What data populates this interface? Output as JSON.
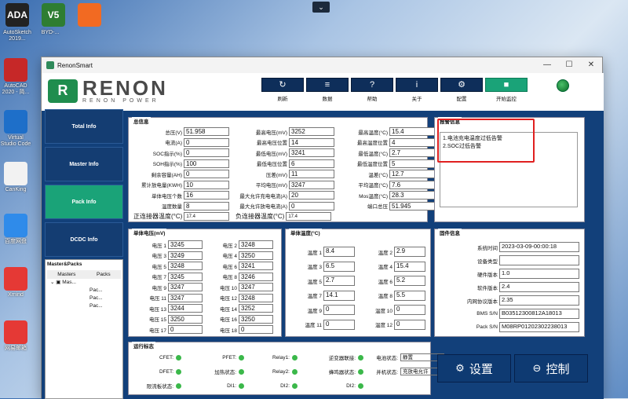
{
  "desktop": {
    "icons": [
      {
        "label": "AutoSketch 2019...",
        "color": "#222"
      },
      {
        "label": "BYD-...",
        "color": "#2e7d32"
      },
      {
        "label": "Virtual Studio Code",
        "color": "#1e6fc9"
      },
      {
        "label": "AutoCAD 2020 - 简...",
        "color": "#c62828"
      },
      {
        "label": "CanKing",
        "color": "#f2f2f2"
      },
      {
        "label": "百度网盘",
        "color": "#2f8bea"
      },
      {
        "label": "Xmind",
        "color": "#e53935"
      },
      {
        "label": "网易邮箱",
        "color": "#e53935"
      }
    ],
    "top_icons": [
      {
        "label": "ADA",
        "color": "#222"
      },
      {
        "label": "V5",
        "color": "#2e7d32"
      },
      {
        "label": "",
        "color": "#f26a22"
      }
    ]
  },
  "window": {
    "title": "RenonSmart",
    "controls": [
      "—",
      "☐",
      "✕"
    ]
  },
  "logo": {
    "brand": "RENON",
    "sub": "RENON POWER",
    "mark": "R"
  },
  "toolbar": [
    {
      "label": "刷新",
      "icon": "refresh-icon",
      "glyph": "↻"
    },
    {
      "label": "数据",
      "icon": "database-icon",
      "glyph": "≡"
    },
    {
      "label": "帮助",
      "icon": "help-icon",
      "glyph": "?"
    },
    {
      "label": "关于",
      "icon": "info-icon",
      "glyph": "i"
    },
    {
      "label": "配置",
      "icon": "gear-icon",
      "glyph": "⚙"
    },
    {
      "label": "开始监控",
      "icon": "stop-icon",
      "glyph": "■"
    }
  ],
  "sidebar": {
    "items": [
      "Total Info",
      "Master Info",
      "Pack Info",
      "DCDC Info"
    ],
    "active": 2
  },
  "tree": {
    "title": "Master&Packs",
    "col_masters": "Masters",
    "col_packs": "Packs",
    "master": "Mas...",
    "packs": [
      "Pac...",
      "Pac...",
      "Pac..."
    ]
  },
  "summary": {
    "title": "总信息",
    "rows": [
      [
        {
          "k": "总压(V)",
          "v": "51.958"
        },
        {
          "k": "最高电压(mV)",
          "v": "3252"
        },
        {
          "k": "最高温度(°C)",
          "v": "15.4"
        }
      ],
      [
        {
          "k": "电流(A)",
          "v": "0"
        },
        {
          "k": "最高电压位置",
          "v": "14"
        },
        {
          "k": "最高温度位置",
          "v": "4"
        }
      ],
      [
        {
          "k": "SOC指示(%)",
          "v": "0"
        },
        {
          "k": "最低电压(mV)",
          "v": "3241"
        },
        {
          "k": "最低温度(°C)",
          "v": "2.7"
        }
      ],
      [
        {
          "k": "SOH指示(%)",
          "v": "100"
        },
        {
          "k": "最低电压位置",
          "v": "6"
        },
        {
          "k": "最低温度位置",
          "v": "5"
        }
      ],
      [
        {
          "k": "剩余容量(AH)",
          "v": "0"
        },
        {
          "k": "压差(mV)",
          "v": "11"
        },
        {
          "k": "温差(°C)",
          "v": "12.7"
        }
      ],
      [
        {
          "k": "累计放电量(KWH)",
          "v": "10"
        },
        {
          "k": "平均电压(mV)",
          "v": "3247"
        },
        {
          "k": "平均温度(°C)",
          "v": "7.6"
        }
      ],
      [
        {
          "k": "单体电压个数",
          "v": "16"
        },
        {
          "k": "最大允许充电电流(A)",
          "v": "20"
        },
        {
          "k": "Mos温度(°C)",
          "v": "28.3"
        }
      ],
      [
        {
          "k": "温度数量",
          "v": "8"
        },
        {
          "k": "最大允许放电电流(A)",
          "v": "0"
        },
        {
          "k": "端口总压",
          "v": "51.945"
        }
      ]
    ],
    "pos_temp_label": "正连接器温度(°C)",
    "pos_temp": "17.4",
    "neg_temp_label": "负连接器温度(°C)",
    "neg_temp": "17.4"
  },
  "alarm": {
    "title": "报警信息",
    "lines": [
      "1.电池充电温度过低告警",
      "2.SOC过低告警"
    ]
  },
  "cells": {
    "title": "单体电压(mV)",
    "items": [
      {
        "k": "电压 1",
        "v": "3245"
      },
      {
        "k": "电压 2",
        "v": "3248"
      },
      {
        "k": "电压 3",
        "v": "3249"
      },
      {
        "k": "电压 4",
        "v": "3250"
      },
      {
        "k": "电压 5",
        "v": "3248"
      },
      {
        "k": "电压 6",
        "v": "3241"
      },
      {
        "k": "电压 7",
        "v": "3245"
      },
      {
        "k": "电压 8",
        "v": "3246"
      },
      {
        "k": "电压 9",
        "v": "3247"
      },
      {
        "k": "电压 10",
        "v": "3247"
      },
      {
        "k": "电压 11",
        "v": "3247"
      },
      {
        "k": "电压 12",
        "v": "3248"
      },
      {
        "k": "电压 13",
        "v": "3244"
      },
      {
        "k": "电压 14",
        "v": "3252"
      },
      {
        "k": "电压 15",
        "v": "3250"
      },
      {
        "k": "电压 16",
        "v": "3250"
      },
      {
        "k": "电压 17",
        "v": "0"
      },
      {
        "k": "电压 18",
        "v": "0"
      }
    ]
  },
  "temps": {
    "title": "单体温度(°C)",
    "items": [
      {
        "k": "温度 1",
        "v": "8.4"
      },
      {
        "k": "温度 2",
        "v": "2.9"
      },
      {
        "k": "温度 3",
        "v": "6.5"
      },
      {
        "k": "温度 4",
        "v": "15.4"
      },
      {
        "k": "温度 5",
        "v": "2.7"
      },
      {
        "k": "温度 6",
        "v": "5.2"
      },
      {
        "k": "温度 7",
        "v": "14.1"
      },
      {
        "k": "温度 8",
        "v": "5.5"
      },
      {
        "k": "温度 9",
        "v": "0"
      },
      {
        "k": "温度 10",
        "v": "0"
      },
      {
        "k": "温度 11",
        "v": "0"
      },
      {
        "k": "温度 12",
        "v": "0"
      }
    ]
  },
  "firmware": {
    "title": "固件信息",
    "rows": [
      {
        "k": "系统时间",
        "v": "2023-03-09-00:00:18"
      },
      {
        "k": "设备类型",
        "v": ""
      },
      {
        "k": "硬件版本",
        "v": "1.0"
      },
      {
        "k": "软件版本",
        "v": "2.4"
      },
      {
        "k": "内网协议版本",
        "v": "2.35"
      },
      {
        "k": "BMS S/N",
        "v": "B03512300812A18013"
      },
      {
        "k": "Pack S/N",
        "v": "M08RP01202302238013"
      }
    ]
  },
  "flags": {
    "title": "运行标志",
    "rows": [
      [
        {
          "k": "CFET:",
          "type": "dot"
        },
        {
          "k": "PFET:",
          "type": "dot"
        },
        {
          "k": "Relay1:",
          "type": "dot"
        },
        {
          "k": "逆变器联接:",
          "type": "dot"
        },
        {
          "k": "电池状态:",
          "type": "val",
          "v": "静置"
        }
      ],
      [
        {
          "k": "DFET:",
          "type": "dot"
        },
        {
          "k": "加热状态:",
          "type": "dot"
        },
        {
          "k": "Relay2:",
          "type": "dot"
        },
        {
          "k": "蜂鸣器状态:",
          "type": "dot"
        },
        {
          "k": "并机状态:",
          "type": "val",
          "v": "充放电允许"
        }
      ],
      [
        {
          "k": "限流板状态:",
          "type": "dot"
        },
        {
          "k": "DI1:",
          "type": "dot"
        },
        {
          "k": "DI2:",
          "type": "dot"
        },
        {
          "k": "DI2:",
          "type": "dot"
        }
      ]
    ]
  },
  "buttons": {
    "settings": "设置",
    "control": "控制"
  }
}
